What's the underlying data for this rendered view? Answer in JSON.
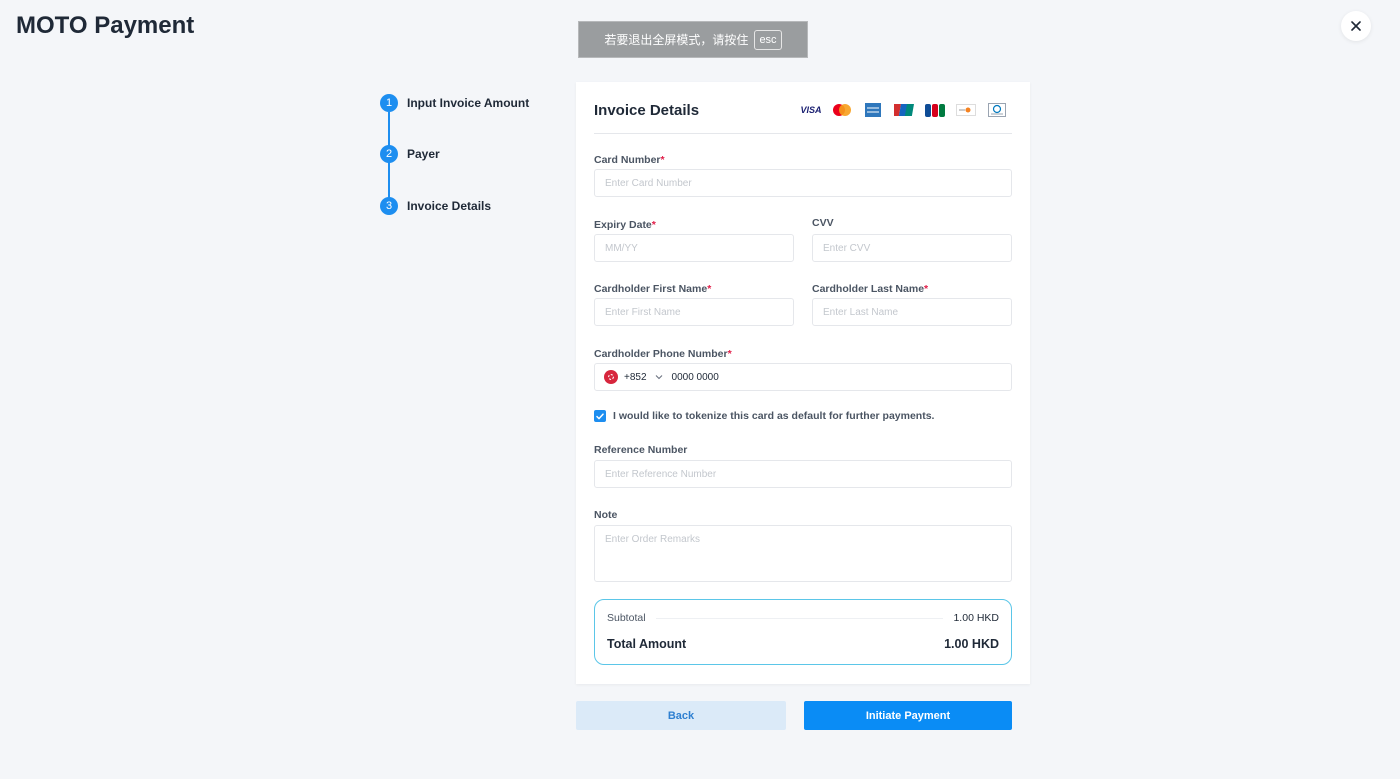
{
  "page": {
    "title": "MOTO Payment"
  },
  "fullscreen_banner": {
    "text": "若要退出全屏模式，请按住",
    "key": "esc"
  },
  "stepper": {
    "steps": [
      {
        "number": "1",
        "label": "Input Invoice Amount"
      },
      {
        "number": "2",
        "label": "Payer"
      },
      {
        "number": "3",
        "label": "Invoice Details"
      }
    ]
  },
  "card": {
    "title": "Invoice Details",
    "brands": [
      "visa-icon",
      "mastercard-icon",
      "amex-icon",
      "unionpay-icon",
      "jcb-icon",
      "discover-icon",
      "diners-icon"
    ],
    "brand_text": {
      "visa": "VISA",
      "jcb": "JCB"
    }
  },
  "form": {
    "card_number": {
      "label": "Card Number",
      "required": "*",
      "placeholder": "Enter Card Number"
    },
    "expiry": {
      "label": "Expiry Date",
      "required": "*",
      "placeholder": "MM/YY"
    },
    "cvv": {
      "label": "CVV",
      "placeholder": "Enter CVV"
    },
    "first_name": {
      "label": "Cardholder First Name",
      "required": "*",
      "placeholder": "Enter First Name"
    },
    "last_name": {
      "label": "Cardholder Last Name",
      "required": "*",
      "placeholder": "Enter Last Name"
    },
    "phone": {
      "label": "Cardholder Phone Number",
      "required": "*",
      "country_code": "+852",
      "value": "0000 0000"
    },
    "tokenize": {
      "label": "I would like to tokenize this card as default for further payments.",
      "checked": true
    },
    "reference": {
      "label": "Reference Number",
      "placeholder": "Enter Reference Number"
    },
    "note": {
      "label": "Note",
      "placeholder": "Enter Order Remarks"
    }
  },
  "summary": {
    "subtotal_label": "Subtotal",
    "subtotal_value": "1.00 HKD",
    "total_label": "Total Amount",
    "total_value": "1.00 HKD"
  },
  "actions": {
    "back": "Back",
    "pay": "Initiate Payment"
  },
  "colors": {
    "accent": "#0a8cf5",
    "required": "#e11d48",
    "summary_border": "#5bc6e8"
  }
}
